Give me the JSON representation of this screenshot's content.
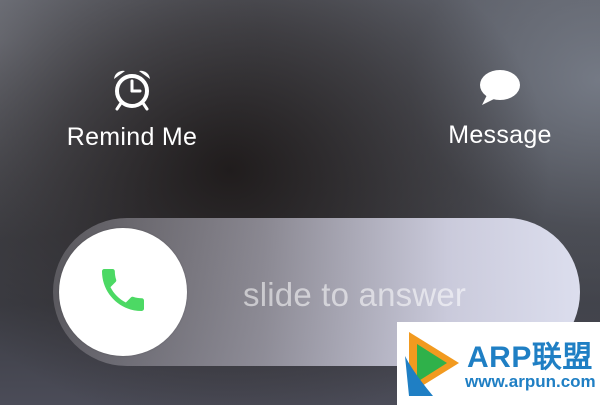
{
  "actions": {
    "remind": {
      "label": "Remind Me",
      "icon": "alarm-clock-icon"
    },
    "message": {
      "label": "Message",
      "icon": "speech-bubble-icon"
    }
  },
  "slider": {
    "text": "slide to answer",
    "knob_icon": "phone-icon",
    "knob_icon_color": "#4cd964"
  },
  "watermark": {
    "brand": "ARP联盟",
    "url": "www.arpun.com",
    "color": "#1f7fc4"
  }
}
